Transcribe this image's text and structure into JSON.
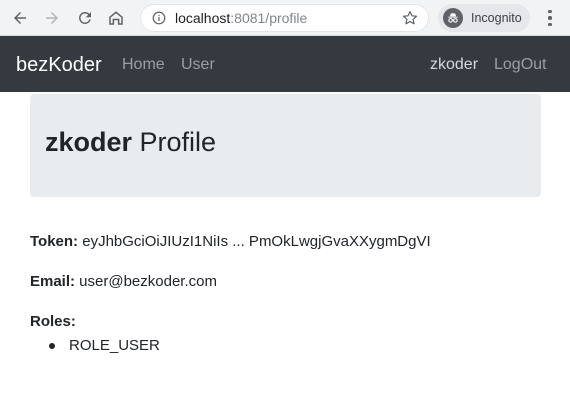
{
  "browser": {
    "url_host": "localhost",
    "url_rest": ":8081/profile",
    "incognito_label": "Incognito",
    "icons": [
      "back-icon",
      "forward-icon",
      "reload-icon",
      "home-icon",
      "info-icon",
      "star-icon",
      "incognito-icon",
      "menu-icon"
    ]
  },
  "navbar": {
    "brand": "bezKoder",
    "links": [
      {
        "label": "Home"
      },
      {
        "label": "User"
      }
    ],
    "right": {
      "username": "zkoder",
      "logout": "LogOut"
    }
  },
  "jumbotron": {
    "username": "zkoder",
    "suffix": " Profile"
  },
  "profile": {
    "token_label": "Token:",
    "token_value": " eyJhbGciOiJIUzI1NiIs ... PmOkLwgjGvaXXygmDgVI",
    "email_label": "Email:",
    "email_value": " user@bezkoder.com",
    "roles_label": "Roles:",
    "roles": [
      "ROLE_USER"
    ]
  },
  "colors": {
    "navbar_bg": "#343a40",
    "jumbotron_bg": "#e9ecef",
    "text": "#212529"
  }
}
